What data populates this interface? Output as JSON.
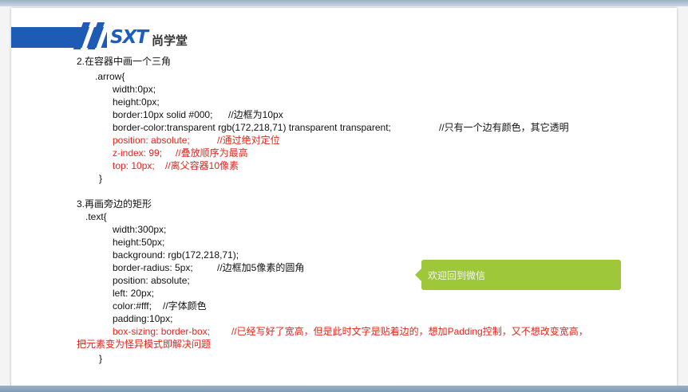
{
  "header": {
    "logo_text": "SXT",
    "logo_cn": "尚学堂"
  },
  "section2": {
    "heading": "2.在容器中画一个三角",
    "selector": ".arrow{",
    "width": "width:0px;",
    "height": "height:0px;",
    "border_code": "border:10px solid #000;",
    "border_comment": "//边框为10px",
    "border_color_code": "border-color:transparent rgb(172,218,71)  transparent transparent;",
    "border_color_comment": "//只有一个边有颜色，其它透明",
    "position_code": "position: absolute;",
    "position_comment": "//通过绝对定位",
    "zindex_code": "z-index: 99;",
    "zindex_comment": "//叠放顺序为最高",
    "top_code": "top: 10px;",
    "top_comment": "//离父容器10像素",
    "close": "}"
  },
  "section3": {
    "heading": "3.再画旁边的矩形",
    "selector": ".text{",
    "width": "width:300px;",
    "height": "height:50px;",
    "background": "background: rgb(172,218,71);",
    "radius_code": "border-radius: 5px;",
    "radius_comment": "//边框加5像素的圆角",
    "position": "position: absolute;",
    "left": "left: 20px;",
    "color_code": "color:#fff;",
    "color_comment": "//字体颜色",
    "padding": "padding:10px;",
    "boxsizing_code": "box-sizing: border-box;",
    "boxsizing_comment": "//已经写好了宽高，但是此时文字是贴着边的，想加Padding控制，又不想改变宽高，",
    "boxsizing_comment2": "把元素变为怪异模式即解决问题",
    "close": "}"
  },
  "demo": {
    "bubble_text": "欢迎回到微信"
  },
  "colors": {
    "accent_green": "#9ec83a",
    "brand_blue": "#1e5bb5",
    "comment_red": "#e8231a"
  }
}
